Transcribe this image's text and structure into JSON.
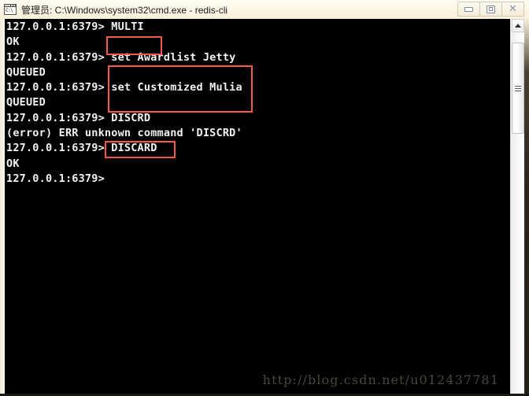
{
  "window": {
    "title": "管理员: C:\\Windows\\system32\\cmd.exe - redis-cli",
    "icon": "cmd-console-icon",
    "icon_text": "C:\\",
    "controls": {
      "minimize_label": "",
      "maximize_label": "",
      "close_label": "✕"
    },
    "colors": {
      "titlebar": "#fdf6e4",
      "console_bg": "#000000",
      "console_fg": "#f2f2f2",
      "annotation": "#f2594b"
    }
  },
  "terminal": {
    "prompt": "127.0.0.1:6379>",
    "lines": [
      "127.0.0.1:6379> MULTI",
      "OK",
      "127.0.0.1:6379> set Awardlist Jetty",
      "QUEUED",
      "127.0.0.1:6379> set Customized Mulia",
      "QUEUED",
      "127.0.0.1:6379> DISCRD",
      "(error) ERR unknown command 'DISCRD'",
      "127.0.0.1:6379> DISCARD",
      "OK",
      "127.0.0.1:6379>"
    ]
  },
  "annotations": [
    {
      "id": "annot-multi",
      "target": "MULTI"
    },
    {
      "id": "annot-sets",
      "target": "set Awardlist Jetty / set Customized Mulia"
    },
    {
      "id": "annot-discard",
      "target": "DISCARD"
    }
  ],
  "watermark": {
    "text": "http://blog.csdn.net/u012437781"
  },
  "scrollbar": {
    "up_arrow": "scroll-up-arrow",
    "position": "top"
  }
}
